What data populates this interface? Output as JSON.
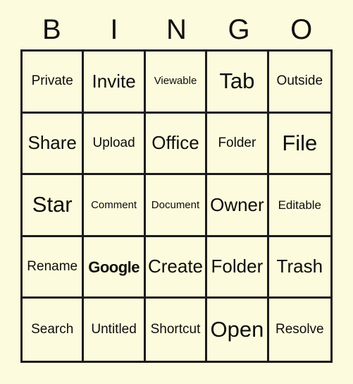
{
  "card": {
    "header_letters": [
      "B",
      "I",
      "N",
      "G",
      "O"
    ],
    "colors": {
      "background": "#FCFBDD",
      "grid_line": "#1b1b1b",
      "text": "#0d0d0d"
    },
    "rows": [
      [
        {
          "label": "Private",
          "size": "m",
          "bold": false
        },
        {
          "label": "Invite",
          "size": "xl",
          "bold": false
        },
        {
          "label": "Viewable",
          "size": "xs",
          "bold": false
        },
        {
          "label": "Tab",
          "size": "xxl",
          "bold": false
        },
        {
          "label": "Outside",
          "size": "m",
          "bold": false
        }
      ],
      [
        {
          "label": "Share",
          "size": "xl",
          "bold": false
        },
        {
          "label": "Upload",
          "size": "m",
          "bold": false
        },
        {
          "label": "Office",
          "size": "xl",
          "bold": false
        },
        {
          "label": "Folder",
          "size": "m",
          "bold": false
        },
        {
          "label": "File",
          "size": "xxl",
          "bold": false
        }
      ],
      [
        {
          "label": "Star",
          "size": "xxl",
          "bold": false
        },
        {
          "label": "Comment",
          "size": "xs",
          "bold": false
        },
        {
          "label": "Document",
          "size": "xs",
          "bold": false
        },
        {
          "label": "Owner",
          "size": "xl",
          "bold": false
        },
        {
          "label": "Editable",
          "size": "s",
          "bold": false
        }
      ],
      [
        {
          "label": "Rename",
          "size": "m",
          "bold": false
        },
        {
          "label": "Google",
          "size": "l",
          "bold": true
        },
        {
          "label": "Create",
          "size": "xl",
          "bold": false
        },
        {
          "label": "Folder",
          "size": "xl",
          "bold": false
        },
        {
          "label": "Trash",
          "size": "xl",
          "bold": false
        }
      ],
      [
        {
          "label": "Search",
          "size": "m",
          "bold": false
        },
        {
          "label": "Untitled",
          "size": "m",
          "bold": false
        },
        {
          "label": "Shortcut",
          "size": "m",
          "bold": false
        },
        {
          "label": "Open",
          "size": "xxl",
          "bold": false
        },
        {
          "label": "Resolve",
          "size": "m",
          "bold": false
        }
      ]
    ]
  }
}
